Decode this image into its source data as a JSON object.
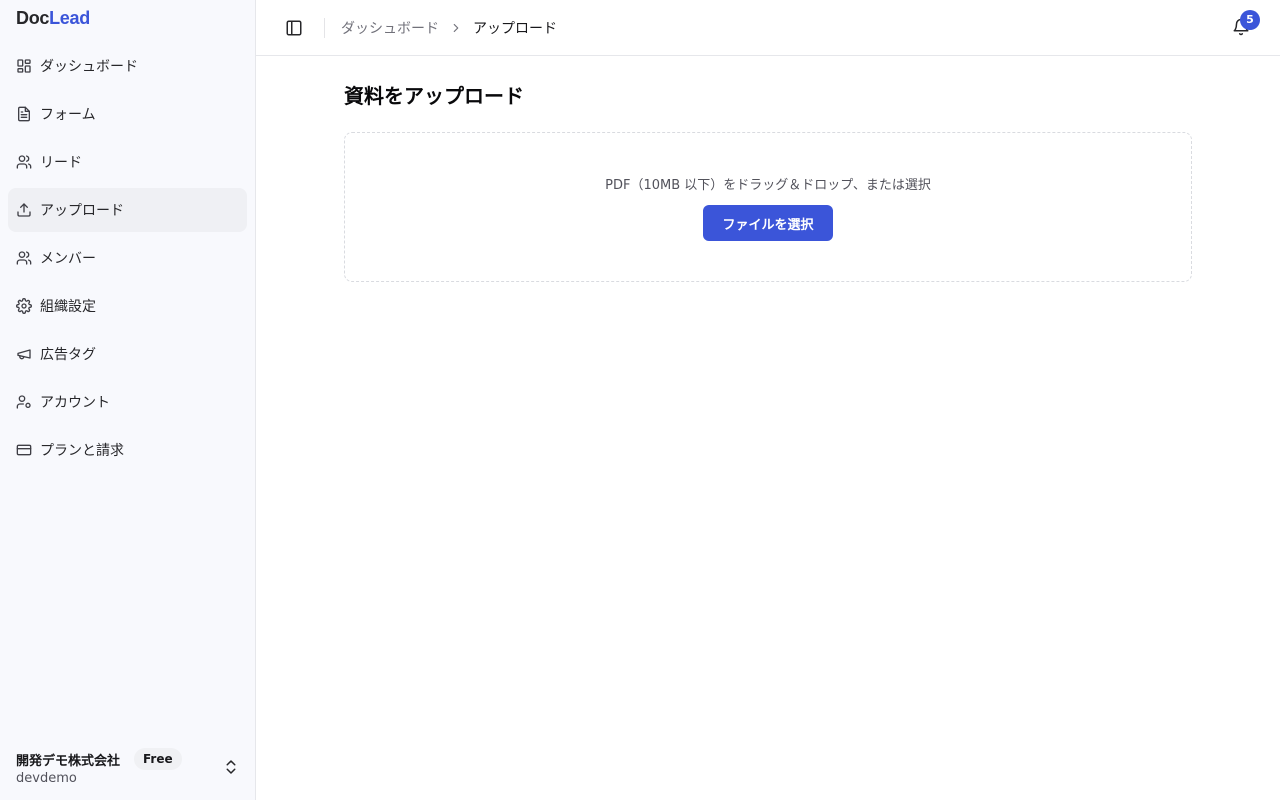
{
  "app": {
    "logo_part1": "Doc",
    "logo_part2": "Lead"
  },
  "sidebar": {
    "items": [
      {
        "label": "ダッシュボード",
        "icon": "layout-grid-icon"
      },
      {
        "label": "フォーム",
        "icon": "file-text-icon"
      },
      {
        "label": "リード",
        "icon": "users-icon"
      },
      {
        "label": "アップロード",
        "icon": "upload-icon",
        "active": true
      },
      {
        "label": "メンバー",
        "icon": "users-icon"
      },
      {
        "label": "組織設定",
        "icon": "gear-icon"
      },
      {
        "label": "広告タグ",
        "icon": "megaphone-icon"
      },
      {
        "label": "アカウント",
        "icon": "user-cog-icon"
      },
      {
        "label": "プランと請求",
        "icon": "credit-card-icon"
      }
    ],
    "org": {
      "name": "開発デモ株式会社",
      "plan": "Free",
      "slug": "devdemo"
    }
  },
  "header": {
    "breadcrumb": {
      "parent": "ダッシュボード",
      "current": "アップロード"
    },
    "notifications_count": "5"
  },
  "main": {
    "title": "資料をアップロード",
    "dropzone": {
      "hint": "PDF（10MB 以下）をドラッグ＆ドロップ、または選択",
      "button_label": "ファイルを選択"
    }
  },
  "colors": {
    "accent": "#3b55d9",
    "sidebar_bg": "#f8f9fd",
    "active_item_bg": "#eff0f4"
  }
}
